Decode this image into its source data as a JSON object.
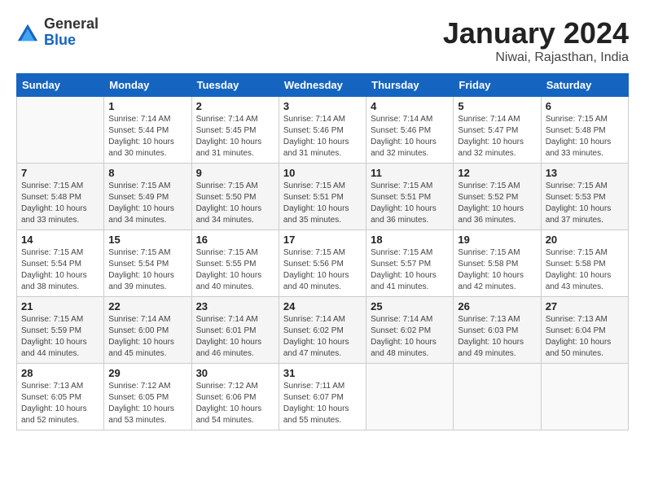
{
  "header": {
    "logo_general": "General",
    "logo_blue": "Blue",
    "month_year": "January 2024",
    "location": "Niwai, Rajasthan, India"
  },
  "calendar": {
    "days_of_week": [
      "Sunday",
      "Monday",
      "Tuesday",
      "Wednesday",
      "Thursday",
      "Friday",
      "Saturday"
    ],
    "weeks": [
      [
        {
          "day": "",
          "info": ""
        },
        {
          "day": "1",
          "info": "Sunrise: 7:14 AM\nSunset: 5:44 PM\nDaylight: 10 hours\nand 30 minutes."
        },
        {
          "day": "2",
          "info": "Sunrise: 7:14 AM\nSunset: 5:45 PM\nDaylight: 10 hours\nand 31 minutes."
        },
        {
          "day": "3",
          "info": "Sunrise: 7:14 AM\nSunset: 5:46 PM\nDaylight: 10 hours\nand 31 minutes."
        },
        {
          "day": "4",
          "info": "Sunrise: 7:14 AM\nSunset: 5:46 PM\nDaylight: 10 hours\nand 32 minutes."
        },
        {
          "day": "5",
          "info": "Sunrise: 7:14 AM\nSunset: 5:47 PM\nDaylight: 10 hours\nand 32 minutes."
        },
        {
          "day": "6",
          "info": "Sunrise: 7:15 AM\nSunset: 5:48 PM\nDaylight: 10 hours\nand 33 minutes."
        }
      ],
      [
        {
          "day": "7",
          "info": "Sunrise: 7:15 AM\nSunset: 5:48 PM\nDaylight: 10 hours\nand 33 minutes."
        },
        {
          "day": "8",
          "info": "Sunrise: 7:15 AM\nSunset: 5:49 PM\nDaylight: 10 hours\nand 34 minutes."
        },
        {
          "day": "9",
          "info": "Sunrise: 7:15 AM\nSunset: 5:50 PM\nDaylight: 10 hours\nand 34 minutes."
        },
        {
          "day": "10",
          "info": "Sunrise: 7:15 AM\nSunset: 5:51 PM\nDaylight: 10 hours\nand 35 minutes."
        },
        {
          "day": "11",
          "info": "Sunrise: 7:15 AM\nSunset: 5:51 PM\nDaylight: 10 hours\nand 36 minutes."
        },
        {
          "day": "12",
          "info": "Sunrise: 7:15 AM\nSunset: 5:52 PM\nDaylight: 10 hours\nand 36 minutes."
        },
        {
          "day": "13",
          "info": "Sunrise: 7:15 AM\nSunset: 5:53 PM\nDaylight: 10 hours\nand 37 minutes."
        }
      ],
      [
        {
          "day": "14",
          "info": "Sunrise: 7:15 AM\nSunset: 5:54 PM\nDaylight: 10 hours\nand 38 minutes."
        },
        {
          "day": "15",
          "info": "Sunrise: 7:15 AM\nSunset: 5:54 PM\nDaylight: 10 hours\nand 39 minutes."
        },
        {
          "day": "16",
          "info": "Sunrise: 7:15 AM\nSunset: 5:55 PM\nDaylight: 10 hours\nand 40 minutes."
        },
        {
          "day": "17",
          "info": "Sunrise: 7:15 AM\nSunset: 5:56 PM\nDaylight: 10 hours\nand 40 minutes."
        },
        {
          "day": "18",
          "info": "Sunrise: 7:15 AM\nSunset: 5:57 PM\nDaylight: 10 hours\nand 41 minutes."
        },
        {
          "day": "19",
          "info": "Sunrise: 7:15 AM\nSunset: 5:58 PM\nDaylight: 10 hours\nand 42 minutes."
        },
        {
          "day": "20",
          "info": "Sunrise: 7:15 AM\nSunset: 5:58 PM\nDaylight: 10 hours\nand 43 minutes."
        }
      ],
      [
        {
          "day": "21",
          "info": "Sunrise: 7:15 AM\nSunset: 5:59 PM\nDaylight: 10 hours\nand 44 minutes."
        },
        {
          "day": "22",
          "info": "Sunrise: 7:14 AM\nSunset: 6:00 PM\nDaylight: 10 hours\nand 45 minutes."
        },
        {
          "day": "23",
          "info": "Sunrise: 7:14 AM\nSunset: 6:01 PM\nDaylight: 10 hours\nand 46 minutes."
        },
        {
          "day": "24",
          "info": "Sunrise: 7:14 AM\nSunset: 6:02 PM\nDaylight: 10 hours\nand 47 minutes."
        },
        {
          "day": "25",
          "info": "Sunrise: 7:14 AM\nSunset: 6:02 PM\nDaylight: 10 hours\nand 48 minutes."
        },
        {
          "day": "26",
          "info": "Sunrise: 7:13 AM\nSunset: 6:03 PM\nDaylight: 10 hours\nand 49 minutes."
        },
        {
          "day": "27",
          "info": "Sunrise: 7:13 AM\nSunset: 6:04 PM\nDaylight: 10 hours\nand 50 minutes."
        }
      ],
      [
        {
          "day": "28",
          "info": "Sunrise: 7:13 AM\nSunset: 6:05 PM\nDaylight: 10 hours\nand 52 minutes."
        },
        {
          "day": "29",
          "info": "Sunrise: 7:12 AM\nSunset: 6:05 PM\nDaylight: 10 hours\nand 53 minutes."
        },
        {
          "day": "30",
          "info": "Sunrise: 7:12 AM\nSunset: 6:06 PM\nDaylight: 10 hours\nand 54 minutes."
        },
        {
          "day": "31",
          "info": "Sunrise: 7:11 AM\nSunset: 6:07 PM\nDaylight: 10 hours\nand 55 minutes."
        },
        {
          "day": "",
          "info": ""
        },
        {
          "day": "",
          "info": ""
        },
        {
          "day": "",
          "info": ""
        }
      ]
    ]
  }
}
